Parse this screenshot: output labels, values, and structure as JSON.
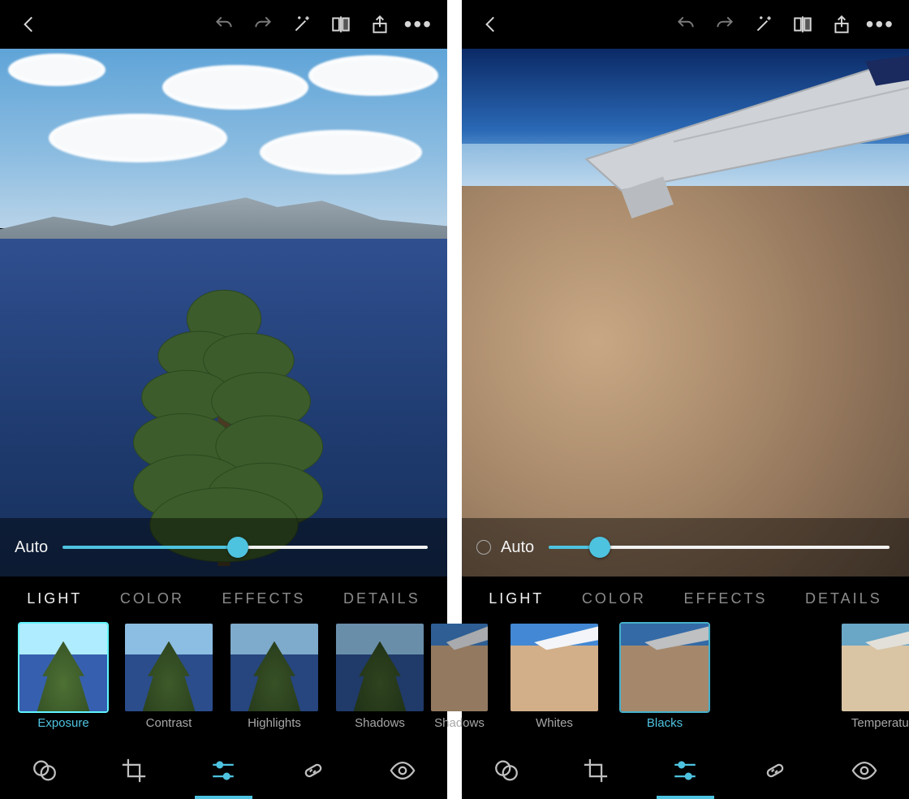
{
  "accent": "#4ec3e0",
  "screens": [
    {
      "id": "left",
      "photo": "lake",
      "auto_label": "Auto",
      "show_auto_circle": false,
      "slider_pct": 48,
      "tabs": [
        {
          "label": "LIGHT",
          "active": true
        },
        {
          "label": "COLOR",
          "active": false
        },
        {
          "label": "EFFECTS",
          "active": false
        },
        {
          "label": "DETAILS",
          "active": false
        }
      ],
      "thumbs": [
        {
          "label": "Exposure",
          "selected": true,
          "kind": "lake",
          "bright": 1.25
        },
        {
          "label": "Contrast",
          "selected": false,
          "kind": "lake",
          "bright": 1.0
        },
        {
          "label": "Highlights",
          "selected": false,
          "kind": "lake",
          "bright": 0.9
        },
        {
          "label": "Shadows",
          "selected": false,
          "kind": "lake",
          "bright": 0.75
        },
        {
          "label": "",
          "selected": false,
          "kind": "lake",
          "bright": 1.4
        }
      ],
      "thumbs_shifted": false,
      "bottom_active_index": 2
    },
    {
      "id": "right",
      "photo": "plane",
      "auto_label": "Auto",
      "show_auto_circle": true,
      "slider_pct": 15,
      "tabs": [
        {
          "label": "LIGHT",
          "active": true
        },
        {
          "label": "COLOR",
          "active": false
        },
        {
          "label": "EFFECTS",
          "active": false
        },
        {
          "label": "DETAILS",
          "active": false
        }
      ],
      "thumbs": [
        {
          "label": "Shadows",
          "selected": false,
          "kind": "plane",
          "bright": 0.8,
          "clip": true
        },
        {
          "label": "Whites",
          "selected": false,
          "kind": "plane",
          "bright": 1.15
        },
        {
          "label": "Blacks",
          "selected": true,
          "kind": "plane",
          "bright": 0.9
        },
        {
          "label": "",
          "selected": false,
          "kind": "blank",
          "bright": 1.0
        },
        {
          "label": "Temperature",
          "selected": false,
          "kind": "warm",
          "bright": 1.0
        }
      ],
      "thumbs_shifted": true,
      "bottom_active_index": 2
    }
  ],
  "topbar_icons": [
    "back",
    "undo",
    "redo",
    "wand",
    "compare",
    "share",
    "more"
  ],
  "bottombar_icons": [
    "filters",
    "crop",
    "adjust",
    "heal",
    "view"
  ]
}
